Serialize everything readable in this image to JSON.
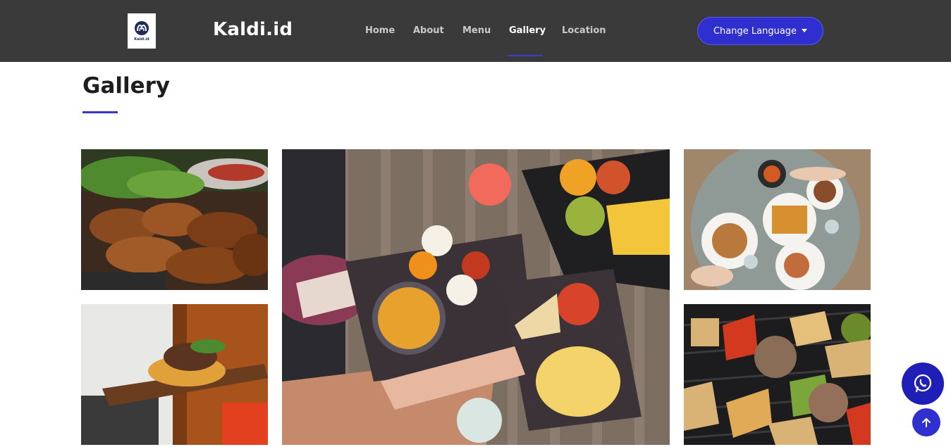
{
  "header": {
    "logo_text": "Kaldi.id",
    "brand": "Kaldi.id",
    "nav": [
      {
        "label": "Home"
      },
      {
        "label": "About"
      },
      {
        "label": "Menu"
      },
      {
        "label": "Gallery"
      },
      {
        "label": "Location"
      }
    ],
    "active_nav": "Gallery",
    "language_button": "Change Language"
  },
  "gallery": {
    "title": "Gallery",
    "images": [
      {
        "name": "grilled-chicken-wings-photo"
      },
      {
        "name": "steak-on-wooden-board-photo"
      },
      {
        "name": "potato-wedges-and-dips-table-photo"
      },
      {
        "name": "waffles-brunch-table-photo"
      },
      {
        "name": "grilled-vegetable-skewers-photo"
      }
    ]
  },
  "floating": {
    "whatsapp_icon": "whatsapp-icon",
    "scroll_top_icon": "arrow-up-icon"
  },
  "colors": {
    "navbar": "#3a3a3a",
    "accent": "#2f2fcf",
    "title_underline": "#3838c8"
  }
}
